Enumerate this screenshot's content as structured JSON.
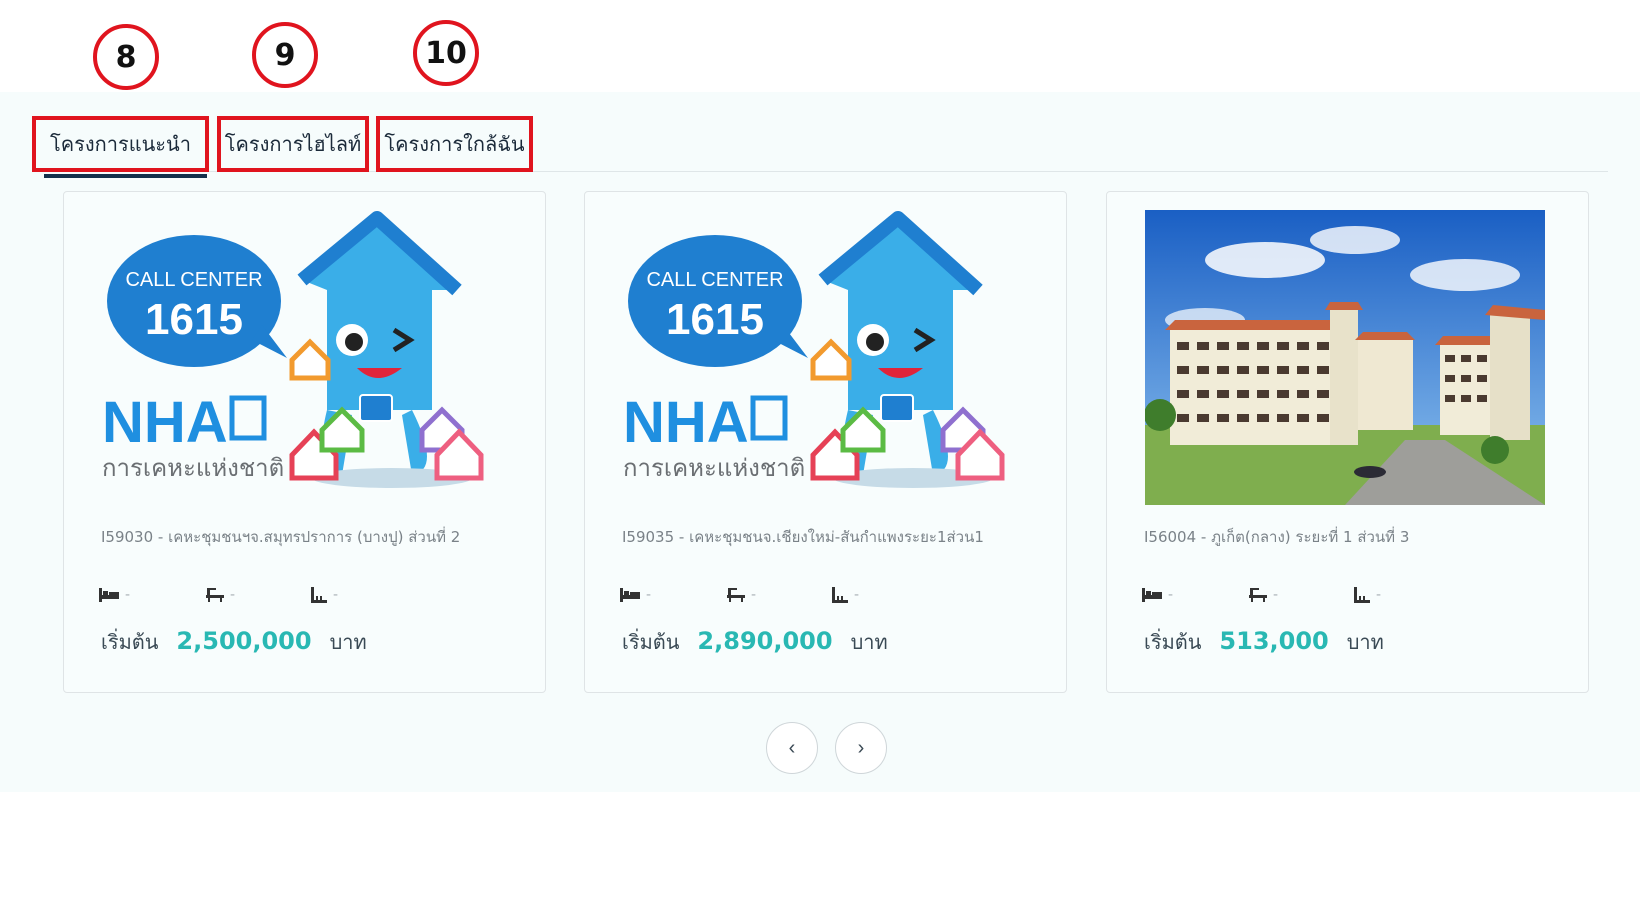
{
  "annotations": [
    "8",
    "9",
    "10"
  ],
  "tabs": [
    {
      "label": "โครงการแนะนำ"
    },
    {
      "label": "โครงการไฮไลท์"
    },
    {
      "label": "โครงการใกล้ฉัน"
    }
  ],
  "cards": [
    {
      "title": "I59030 - เคหะชุมชนฯจ.สมุทรปราการ (บางปู) ส่วนที่ 2",
      "image": {
        "type": "nha-logo",
        "callcenter": "CALL CENTER",
        "number": "1615",
        "brand": "NHA",
        "org": "การเคหะแห่งชาติ"
      },
      "bed": "-",
      "bath": "-",
      "area": "-",
      "price_prefix": "เริ่มต้น",
      "price": "2,500,000",
      "price_suffix": "บาท"
    },
    {
      "title": "I59035 - เคหะชุมชนจ.เชียงใหม่-สันกำแพงระยะ1ส่วน1",
      "image": {
        "type": "nha-logo",
        "callcenter": "CALL CENTER",
        "number": "1615",
        "brand": "NHA",
        "org": "การเคหะแห่งชาติ"
      },
      "bed": "-",
      "bath": "-",
      "area": "-",
      "price_prefix": "เริ่มต้น",
      "price": "2,890,000",
      "price_suffix": "บาท"
    },
    {
      "title": "I56004 - ภูเก็ต(กลาง) ระยะที่ 1 ส่วนที่ 3",
      "image": {
        "type": "building-photo"
      },
      "bed": "-",
      "bath": "-",
      "area": "-",
      "price_prefix": "เริ่มต้น",
      "price": "513,000",
      "price_suffix": "บาท"
    }
  ],
  "nav": {
    "prev": "‹",
    "next": "›"
  },
  "colors": {
    "accent_price": "#29b8b3",
    "highlight_box": "#e0141e",
    "active_tab_underline": "#14304b",
    "nha_blue": "#1f7fd0"
  }
}
